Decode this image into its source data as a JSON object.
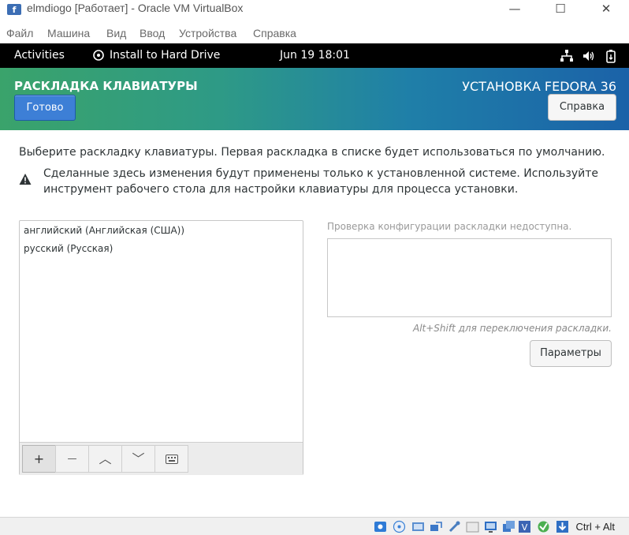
{
  "window": {
    "title": "elmdiogo [Работает] - Oracle VM VirtualBox",
    "minimize_glyph": "—",
    "maximize_glyph": "☐",
    "close_glyph": "✕"
  },
  "menubar": {
    "items": [
      "Файл",
      "Машина",
      "Вид",
      "Ввод",
      "Устройства",
      "Справка"
    ]
  },
  "gnome_bar": {
    "activities": "Activities",
    "app": "Install to Hard Drive",
    "clock": "Jun 19  18:01"
  },
  "header": {
    "screen_title": "РАСКЛАДКА КЛАВИАТУРЫ",
    "product": "УСТАНОВКА FEDORA 36",
    "done_label": "Готово",
    "help_label": "Справка"
  },
  "content": {
    "description": "Выберите раскладку клавиатуры. Первая раскладка в списке будет использоваться по умолчанию.",
    "warning": "Сделанные здесь изменения будут применены только к установленной системе. Используйте инструмент рабочего стола для настройки клавиатуры для процесса установки.",
    "layouts": [
      "английский (Английская (США))",
      "русский (Русская)"
    ],
    "tools": {
      "add": "+",
      "remove": "—",
      "up": "︿",
      "down": "﹀"
    },
    "preview_label": "Проверка конфигурации раскладки недоступна.",
    "switch_hint": "Alt+Shift для переключения раскладки.",
    "options_label": "Параметры"
  },
  "statusbar": {
    "host_key": "Ctrl + Alt"
  },
  "colors": {
    "header_gradient_start": "#3aa36b",
    "header_gradient_end": "#1b62a8",
    "done_button": "#3d7fd6"
  }
}
